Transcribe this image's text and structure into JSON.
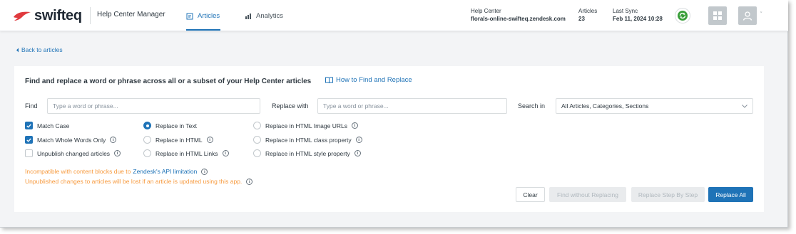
{
  "brand": {
    "name": "swifteq",
    "logo_color": "#e03a3e"
  },
  "header": {
    "app_title": "Help Center Manager",
    "tabs": [
      {
        "label": "Articles",
        "icon": "document-icon",
        "active": true
      },
      {
        "label": "Analytics",
        "icon": "bar-chart-icon",
        "active": false
      }
    ],
    "help_center": {
      "label": "Help Center",
      "value": "florals-online-swifteq.zendesk.com"
    },
    "articles": {
      "label": "Articles",
      "value": "23"
    },
    "last_sync": {
      "label": "Last Sync",
      "value": "Feb 11, 2024 10:28"
    },
    "sync_icon": "sync-icon",
    "apps_icon": "grid-icon",
    "user_icon": "user-icon",
    "caret": "ˇ"
  },
  "back_link": "Back to articles",
  "panel": {
    "title": "Find and replace a word or phrase across all or a subset of your Help Center articles",
    "howto_link": "How to Find and Replace",
    "find": {
      "label": "Find",
      "placeholder": "Type a word or phrase...",
      "value": ""
    },
    "replace": {
      "label": "Replace with",
      "placeholder": "Type a word or phrase...",
      "value": ""
    },
    "search_in": {
      "label": "Search in",
      "value": "All Articles, Categories, Sections"
    },
    "checkboxes": [
      {
        "label": "Match Case",
        "checked": true,
        "info": false
      },
      {
        "label": "Match Whole Words Only",
        "checked": true,
        "info": true
      },
      {
        "label": "Unpublish changed articles",
        "checked": false,
        "info": true
      }
    ],
    "radios_col1": [
      {
        "label": "Replace in Text",
        "checked": true,
        "info": false
      },
      {
        "label": "Replace in HTML",
        "checked": false,
        "info": true
      },
      {
        "label": "Replace in HTML Links",
        "checked": false,
        "info": true
      }
    ],
    "radios_col2": [
      {
        "label": "Replace in HTML Image URLs",
        "checked": false,
        "info": true
      },
      {
        "label": "Replace in HTML class property",
        "checked": false,
        "info": true
      },
      {
        "label": "Replace in HTML style property",
        "checked": false,
        "info": true
      }
    ],
    "warnings": {
      "line1_prefix": "Incompatible with content blocks due to",
      "line1_link": "Zendesk's API limitation",
      "line2": "Unpublished changes to articles will be lost if an article is updated using this app."
    },
    "buttons": {
      "clear": "Clear",
      "find_only": "Find without Replacing",
      "step": "Replace Step By Step",
      "replace_all": "Replace All"
    }
  },
  "colors": {
    "accent": "#1f73b7",
    "warning": "#f79a3e",
    "sync_green": "#3a9f3a"
  }
}
